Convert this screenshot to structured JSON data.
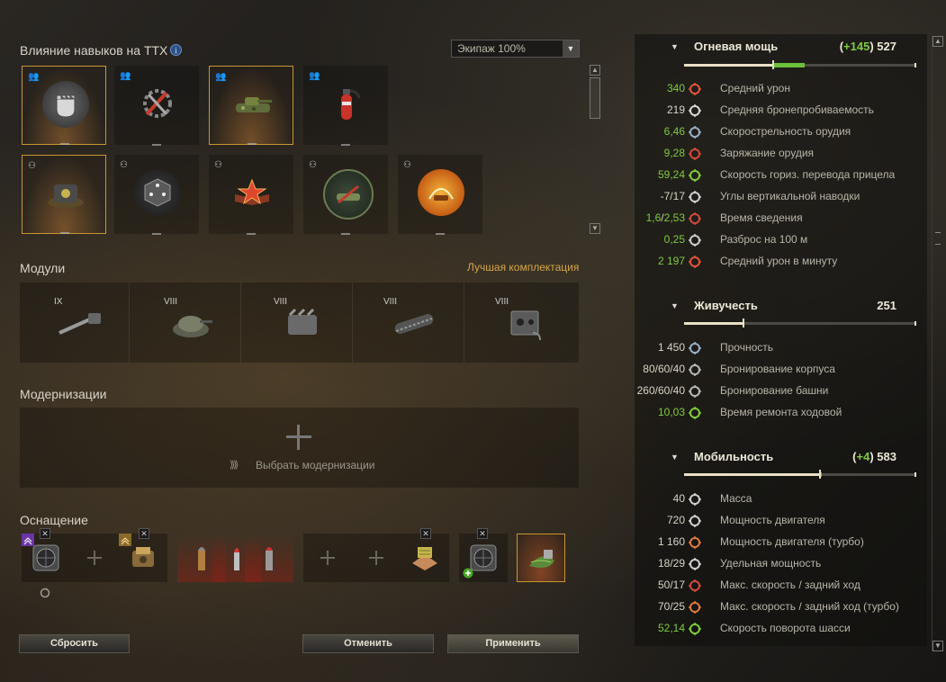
{
  "skills": {
    "title": "Влияние навыков на ТТХ",
    "crew_dropdown": "Экипаж 100%",
    "row1": [
      {
        "icon": "fist-icon",
        "active": true
      },
      {
        "icon": "wrench-tools-icon",
        "active": false
      },
      {
        "icon": "camouflage-tank-icon",
        "active": true
      },
      {
        "icon": "fire-extinguisher-icon",
        "active": false
      }
    ],
    "row2": [
      {
        "icon": "commander-hat-icon",
        "active": true
      },
      {
        "icon": "dice-cube-icon",
        "active": false
      },
      {
        "icon": "star-book-icon",
        "active": false
      },
      {
        "icon": "tank-emblem-icon",
        "active": false
      },
      {
        "icon": "radar-tank-icon",
        "active": false
      }
    ]
  },
  "modules": {
    "title": "Модули",
    "best_link": "Лучшая комплектация",
    "items": [
      {
        "tier": "IX",
        "icon": "gun-icon"
      },
      {
        "tier": "VIII",
        "icon": "turret-icon"
      },
      {
        "tier": "VIII",
        "icon": "engine-icon"
      },
      {
        "tier": "VIII",
        "icon": "tracks-icon"
      },
      {
        "tier": "VIII",
        "icon": "radio-icon"
      }
    ]
  },
  "modernizations": {
    "title": "Модернизации",
    "select_label": "Выбрать модернизации",
    "chevrons": "⟫⟫"
  },
  "equipment": {
    "title": "Оснащение"
  },
  "buttons": {
    "reset": "Сбросить",
    "cancel": "Отменить",
    "apply": "Применить"
  },
  "groups": {
    "firepower": {
      "name": "Огневая мощь",
      "bonus": "+145",
      "value": "527",
      "fill": 0.38,
      "bonus_fill": 0.14,
      "stats": [
        {
          "value": "340",
          "green": true,
          "icon": "damage-icon",
          "label": "Средний урон"
        },
        {
          "value": "219",
          "green": false,
          "icon": "penetration-icon",
          "label": "Средняя бронепробиваемость"
        },
        {
          "value": "6,46",
          "green": true,
          "icon": "rate-of-fire-icon",
          "label": "Скорострельность орудия"
        },
        {
          "value": "9,28",
          "green": true,
          "icon": "reload-icon",
          "label": "Заряжание орудия"
        },
        {
          "value": "59,24",
          "green": true,
          "icon": "traverse-icon",
          "label": "Скорость гориз. перевода прицела"
        },
        {
          "value": "-7/17",
          "green": false,
          "icon": "elevation-icon",
          "label": "Углы вертикальной наводки"
        },
        {
          "value_a": "1,6",
          "value_sep": "/",
          "value_b": "2,53",
          "green": true,
          "icon": "aim-time-icon",
          "label": "Время сведения"
        },
        {
          "value": "0,25",
          "green": true,
          "icon": "dispersion-icon",
          "label": "Разброс на 100 м"
        },
        {
          "value": "2 197",
          "green": true,
          "icon": "dpm-icon",
          "label": "Средний урон в минуту"
        }
      ]
    },
    "survivability": {
      "name": "Живучесть",
      "bonus": "",
      "value": "251",
      "fill": 0.25,
      "bonus_fill": 0,
      "stats": [
        {
          "value": "1 450",
          "green": false,
          "icon": "hitpoints-icon",
          "label": "Прочность"
        },
        {
          "value": "80/60/40",
          "green": false,
          "icon": "hull-armor-icon",
          "label": "Бронирование корпуса"
        },
        {
          "value": "260/60/40",
          "green": false,
          "icon": "turret-armor-icon",
          "label": "Бронирование башни"
        },
        {
          "value": "10,03",
          "green": true,
          "icon": "repair-icon",
          "label": "Время ремонта ходовой"
        }
      ]
    },
    "mobility": {
      "name": "Мобильность",
      "bonus": "+4",
      "value": "583",
      "fill": 0.58,
      "bonus_fill": 0.01,
      "stats": [
        {
          "value": "40",
          "green": false,
          "icon": "weight-icon",
          "label": "Масса"
        },
        {
          "value": "720",
          "green": false,
          "icon": "engine-power-icon",
          "label": "Мощность двигателя"
        },
        {
          "value": "1 160",
          "green": false,
          "icon": "engine-turbo-icon",
          "label": "Мощность двигателя (турбо)"
        },
        {
          "value": "18/29",
          "green": false,
          "icon": "specific-power-icon",
          "label": "Удельная мощность"
        },
        {
          "value": "50/17",
          "green": false,
          "icon": "speed-icon",
          "label": "Макс. скорость / задний ход"
        },
        {
          "value": "70/25",
          "green": false,
          "icon": "speed-turbo-icon",
          "label": "Макс. скорость / задний ход (турбо)"
        },
        {
          "value": "52,14",
          "green": true,
          "icon": "hull-traverse-icon",
          "label": "Скорость поворота шасси"
        }
      ]
    }
  }
}
